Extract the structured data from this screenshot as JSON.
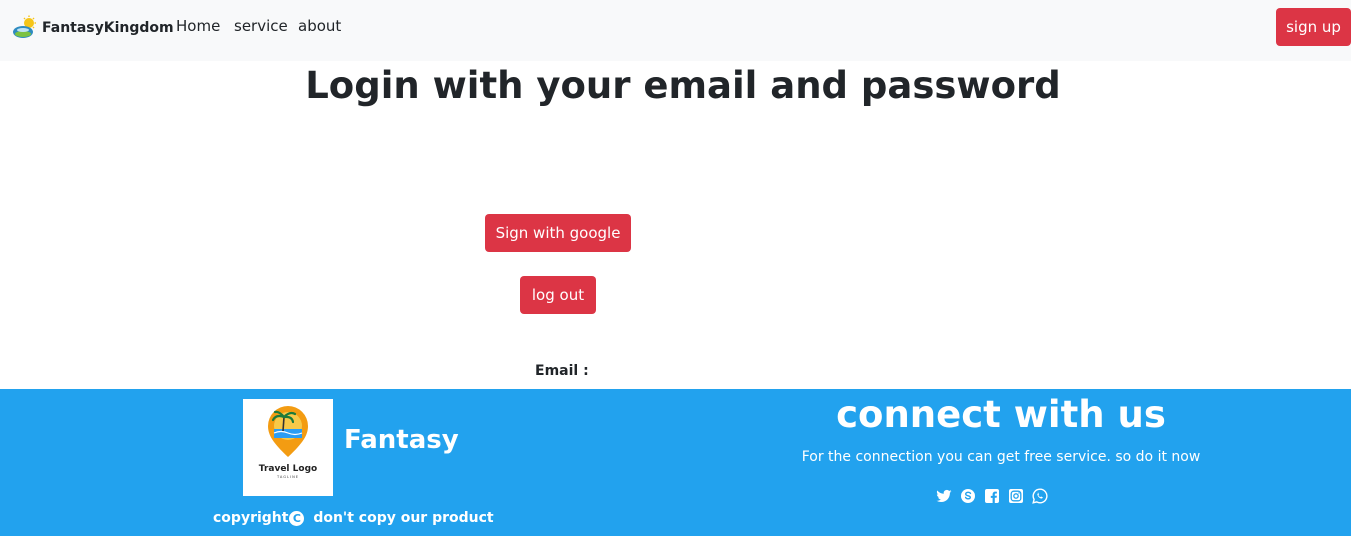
{
  "navbar": {
    "brand": "FantasyKingdom",
    "links": [
      "Home",
      "service",
      "about"
    ],
    "signup_label": "sign up"
  },
  "main": {
    "title": "Login with your email and password",
    "google_label": "Sign with google",
    "logout_label": "log out",
    "email_label": "Email :"
  },
  "footer": {
    "logo_text": "Travel Logo",
    "logo_tagline": "TAGLINE",
    "brand": "Fantasy",
    "copyright_before": "copyright",
    "copyright_symbol": "C",
    "copyright_after": " don't copy our product",
    "connect_title": "connect with us",
    "connect_subtitle": "For the connection you can get free service. so do it now",
    "social_icons": [
      "twitter-icon",
      "skype-icon",
      "facebook-icon",
      "instagram-icon",
      "whatsapp-icon"
    ]
  },
  "colors": {
    "navbar_bg": "#f8f9fa",
    "button_red": "#dc3545",
    "footer_blue": "#22a2ee"
  }
}
